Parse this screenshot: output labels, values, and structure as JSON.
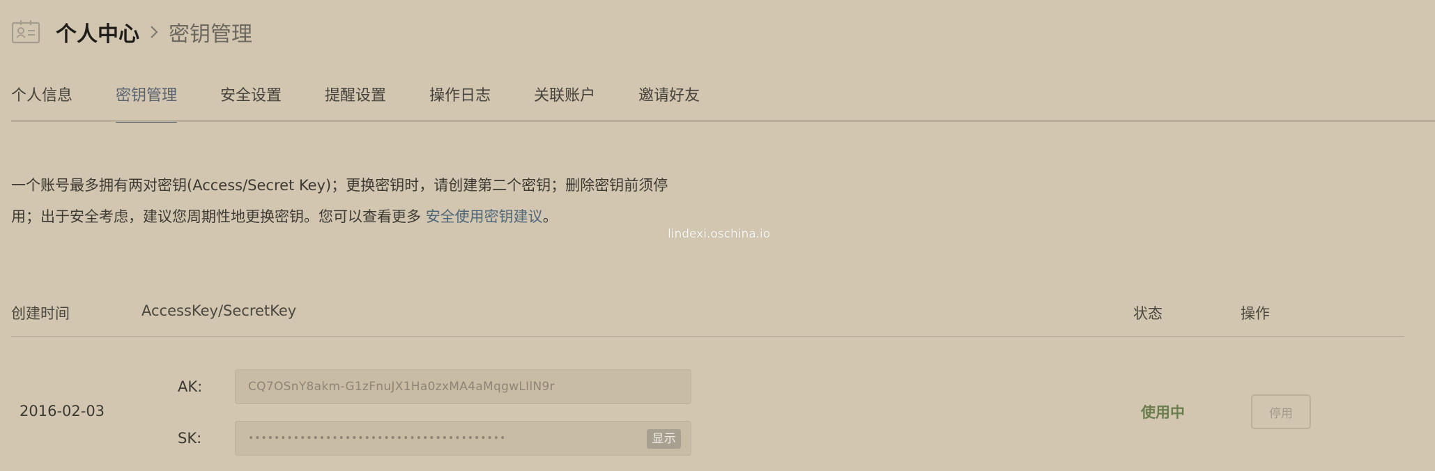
{
  "header": {
    "icon": "id-card-icon",
    "breadcrumb_root": "个人中心",
    "breadcrumb_separator_icon": "chevron-right-icon",
    "breadcrumb_current": "密钥管理"
  },
  "tabs": [
    {
      "label": "个人信息",
      "active": false
    },
    {
      "label": "密钥管理",
      "active": true
    },
    {
      "label": "安全设置",
      "active": false
    },
    {
      "label": "提醒设置",
      "active": false
    },
    {
      "label": "操作日志",
      "active": false
    },
    {
      "label": "关联账户",
      "active": false
    },
    {
      "label": "邀请好友",
      "active": false
    }
  ],
  "notice": {
    "line1": "一个账号最多拥有两对密钥(Access/Secret Key)；更换密钥时，请创建第二个密钥；删除密钥前须停",
    "line2_text": "用；出于安全考虑，建议您周期性地更换密钥。您可以查看更多 ",
    "link": "安全使用密钥建议",
    "line2_end": "。"
  },
  "watermark": "lindexi.oschina.io",
  "table": {
    "headers": {
      "created": "创建时间",
      "keys": "AccessKey/SecretKey",
      "status": "状态",
      "ops": "操作"
    },
    "rows": [
      {
        "created": "2016-02-03",
        "ak_label": "AK:",
        "ak_value": "CQ7OSnY8akm-G1zFnuJX1Ha0zxMA4aMqgwLIlN9r",
        "sk_label": "SK:",
        "sk_value": "••••••••••••••••••••••••••••••••••••••••",
        "show_label": "显示",
        "status": "使用中",
        "action": "停用"
      }
    ]
  },
  "colors": {
    "background": "#d2c6b0",
    "tab_active": "#55616d",
    "link": "#4f6678",
    "status_active": "#6b7d4e"
  }
}
